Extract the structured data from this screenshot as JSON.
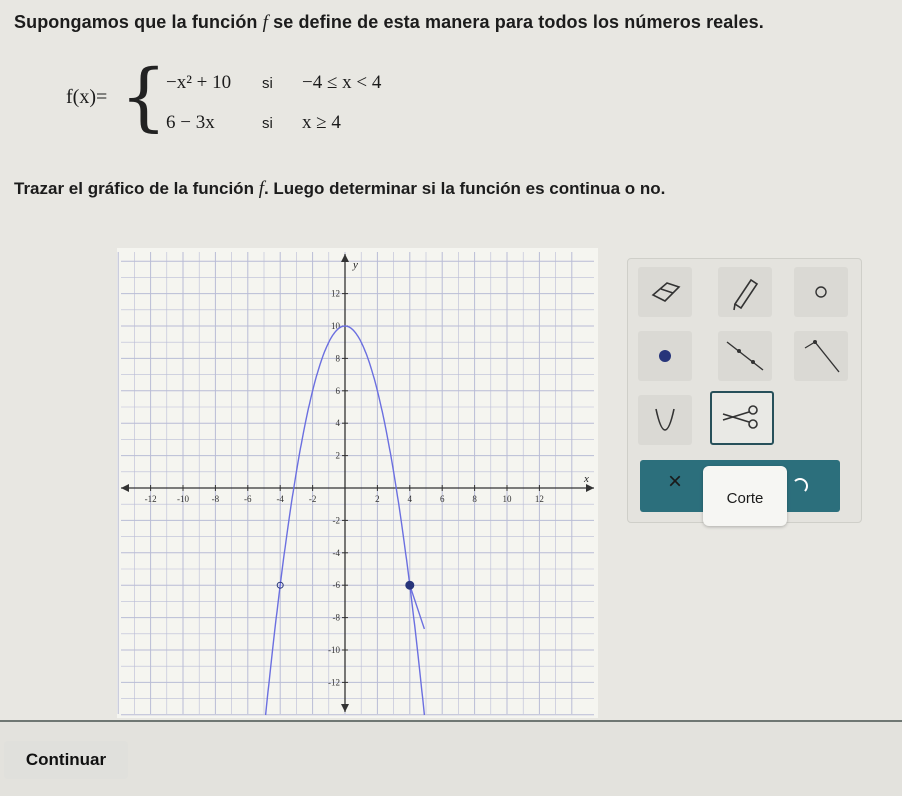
{
  "prompt": {
    "part1": "Supongamos que la función",
    "fname": "f",
    "part2": "se define de esta manera para todos los números reales."
  },
  "function": {
    "lhs": "f(x)=",
    "rows": [
      {
        "expr": "−x² + 10",
        "si": "si",
        "cond": "−4 ≤ x < 4"
      },
      {
        "expr": "6 − 3x",
        "si": "si",
        "cond": "x ≥ 4"
      }
    ]
  },
  "instruction": {
    "part1": "Trazar el gráfico de la función",
    "fname": "f",
    "part2": ". Luego determinar si la función es continua o no."
  },
  "graph": {
    "x_axis_label": "x",
    "y_axis_label": "y",
    "x_range": [
      -14,
      14
    ],
    "y_range": [
      -14,
      14
    ],
    "x_tick_labels": [
      "-12",
      "-10",
      "-8",
      "-6",
      "-4",
      "-2",
      "2",
      "4",
      "6",
      "8",
      "10",
      "12"
    ],
    "y_tick_labels": [
      "12",
      "10",
      "8",
      "6",
      "4",
      "2",
      "-2",
      "-4",
      "-6",
      "-8",
      "-10",
      "-12"
    ],
    "curve_color": "#6b6fe0",
    "open_point": {
      "x": -4,
      "y": -6
    },
    "closed_point": {
      "x": 4,
      "y": -6
    }
  },
  "tools": {
    "items": [
      {
        "name": "eraser-tool",
        "icon": "eraser-icon"
      },
      {
        "name": "pencil-tool",
        "icon": "pencil-icon"
      },
      {
        "name": "open-point-tool",
        "icon": "open-circle-icon"
      },
      {
        "name": "closed-point-tool",
        "icon": "filled-circle-icon"
      },
      {
        "name": "segment-tool",
        "icon": "segment-icon"
      },
      {
        "name": "ray-tool",
        "icon": "ray-icon"
      },
      {
        "name": "parabola-tool",
        "icon": "parabola-icon"
      },
      {
        "name": "scissors-tool",
        "icon": "scissors-icon"
      }
    ],
    "cut_label": "Corte",
    "close_symbol": "×"
  },
  "footer": {
    "continue_label": "Continuar"
  },
  "colors": {
    "accent": "#2c6f7c",
    "point": "#27357a"
  }
}
